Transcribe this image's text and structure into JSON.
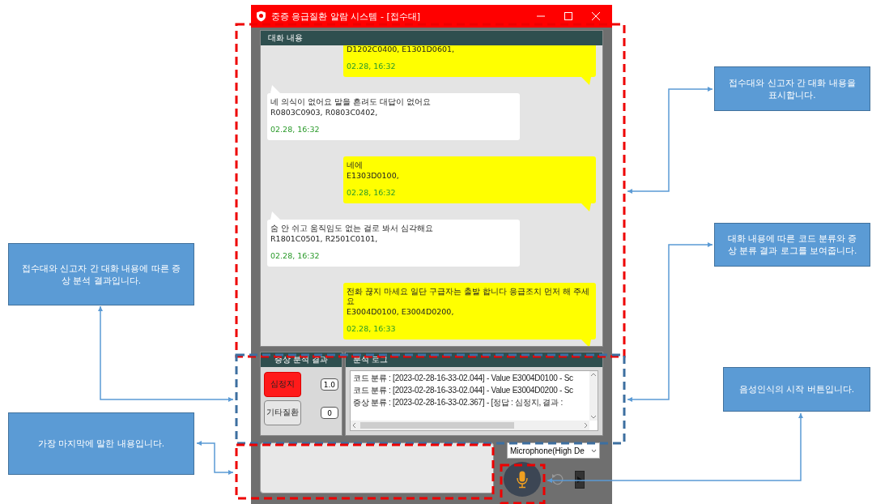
{
  "window": {
    "title": "중증 응급질환 알람 시스템 - [접수대]"
  },
  "chat": {
    "title": "대화 내용",
    "messages": [
      {
        "kind": "sent",
        "codes": "D1202C0400, E1301D0601,",
        "time": "02.28, 16:32"
      },
      {
        "kind": "received",
        "text": "네 의식이 없어요 말을 흔려도 대답이 없어요",
        "codes": "R0803C0903, R0803C0402,",
        "time": "02.28, 16:32"
      },
      {
        "kind": "sent",
        "text": "네에",
        "codes": "E1303D0100,",
        "time": "02.28, 16:32"
      },
      {
        "kind": "received",
        "text": "숨 안 쉬고 움직임도 없는 걸로 봐서 심각해요",
        "codes": "R1801C0501, R2501C0101,",
        "time": "02.28, 16:32"
      },
      {
        "kind": "sent",
        "text": "전화 끊지 마세요 일단 구급자는 출발 합니다 응급조치 먼저 해 주세요",
        "codes": "E3004D0100, E3004D0200,",
        "time": "02.28, 16:33"
      }
    ]
  },
  "symptoms": {
    "title": "증상 분석 결과",
    "items": [
      {
        "label": "심정지",
        "value": "1.0",
        "selected": true
      },
      {
        "label": "기타질환",
        "value": "0",
        "selected": false
      }
    ]
  },
  "log": {
    "title": "분석 로그",
    "lines": [
      "코드 분류 : [2023-02-28-16-33-02.044] - Value E3004D0100 - Sc",
      "코드 분류 : [2023-02-28-16-33-02.044] - Value E3004D0200 - Sc",
      "증상 분류 : [2023-02-28-16-33-02.367] - [정답 : 심정지, 결과 :"
    ]
  },
  "microphone": {
    "value": "Microphone(High De"
  },
  "callouts": [
    {
      "text": "접수대와 신고자 간 대화 내용을 표시합니다."
    },
    {
      "text": "대화 내용에 따른 코드 분류와 증상 분류 결과 로그를 보여줍니다."
    },
    {
      "text": "접수대와 신고자 간 대화 내용에 따른 증상 분석 결과입니다."
    },
    {
      "text": "가장 마지막에 말한 내용입니다."
    },
    {
      "text": "음성인식의 시작 버튼입니다."
    }
  ]
}
